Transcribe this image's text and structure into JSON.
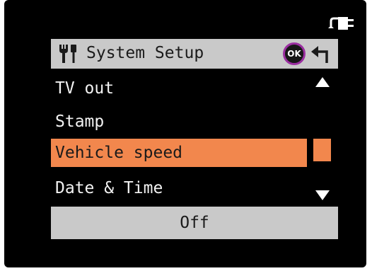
{
  "header": {
    "title": "System Setup",
    "ok_label": "OK",
    "icons": {
      "left": "wrench-screwdriver-icon",
      "ok": "ok-button-icon",
      "back": "return-arrow-icon",
      "power": "power-plug-icon"
    }
  },
  "menu": {
    "items": [
      {
        "label": "TV out"
      },
      {
        "label": "Stamp"
      },
      {
        "label": "Vehicle speed"
      },
      {
        "label": "Date & Time"
      }
    ],
    "selected_index": 2
  },
  "value_bar": {
    "value": "Off"
  },
  "colors": {
    "background": "#000000",
    "bar_gray": "#c9c9c9",
    "highlight_orange": "#f2874d",
    "ok_ring": "#9a2ea0"
  }
}
